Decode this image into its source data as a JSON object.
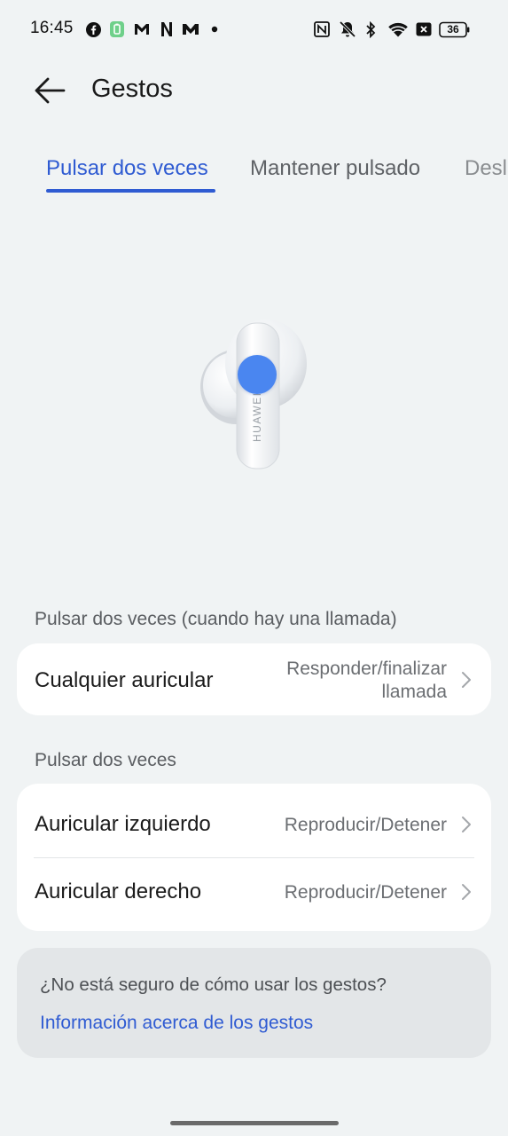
{
  "status_bar": {
    "time": "16:45",
    "battery": "36",
    "left_icons": [
      "facebook-icon",
      "battery-app-icon",
      "gmail-icon",
      "netflix-icon",
      "mail-icon",
      "dot-icon"
    ],
    "right_icons": [
      "nfc-icon",
      "mute-icon",
      "bluetooth-icon",
      "wifi-icon",
      "close-box-icon",
      "battery-icon"
    ]
  },
  "header": {
    "back_icon": "arrow-left-icon",
    "title": "Gestos"
  },
  "tabs": [
    {
      "label": "Pulsar dos veces",
      "active": true
    },
    {
      "label": "Mantener pulsado",
      "active": false
    },
    {
      "label": "Deslizar",
      "active": false
    }
  ],
  "illustration": {
    "brand_text": "HUAWEI",
    "hotspot_color": "#4a86f0"
  },
  "sections": [
    {
      "label": "Pulsar dos veces (cuando hay una llamada)",
      "rows": [
        {
          "label": "Cualquier auricular",
          "value_line1": "Responder/finalizar",
          "value_line2": "llamada"
        }
      ]
    },
    {
      "label": "Pulsar dos veces",
      "rows": [
        {
          "label": "Auricular izquierdo",
          "value": "Reproducir/Detener"
        },
        {
          "label": "Auricular derecho",
          "value": "Reproducir/Detener"
        }
      ]
    }
  ],
  "help": {
    "question": "¿No está seguro de cómo usar los gestos?",
    "link": "Información acerca de los gestos"
  },
  "colors": {
    "accent": "#2f5bd2",
    "background": "#f0f3f4",
    "card": "#ffffff"
  }
}
